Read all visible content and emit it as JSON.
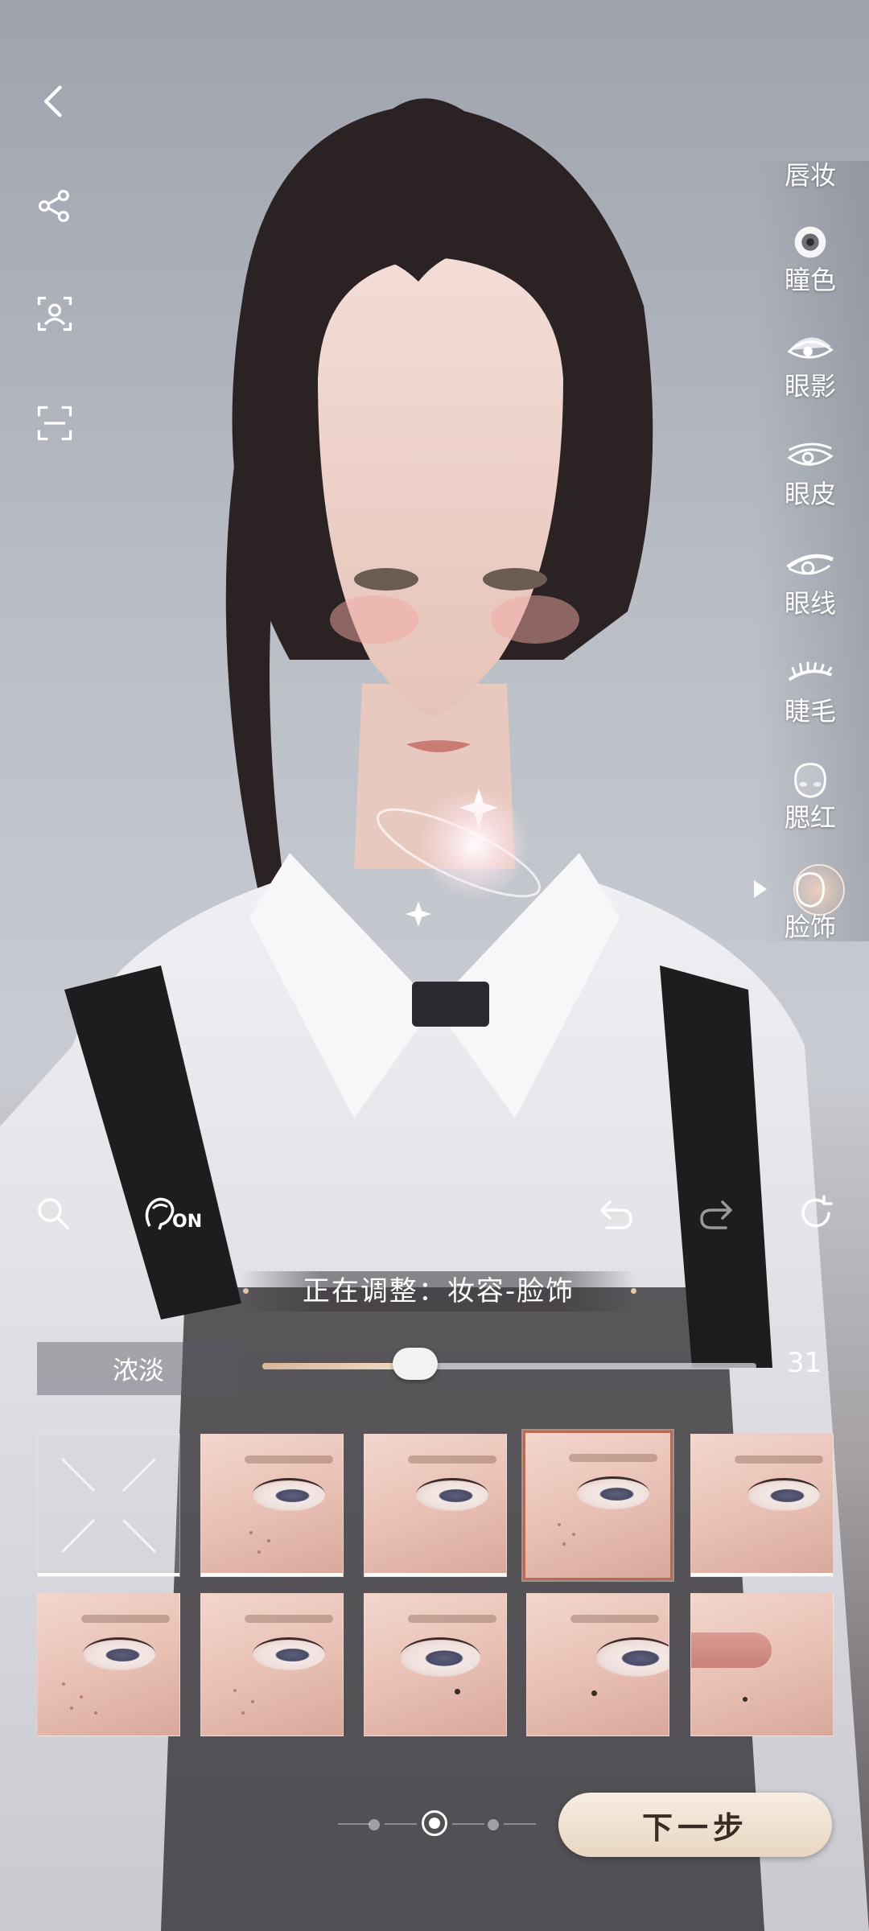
{
  "categories": [
    {
      "label": "唇妆",
      "icon": "lips-icon"
    },
    {
      "label": "瞳色",
      "icon": "pupil-icon"
    },
    {
      "label": "眼影",
      "icon": "eyeshadow-icon"
    },
    {
      "label": "眼皮",
      "icon": "eyelid-icon"
    },
    {
      "label": "眼线",
      "icon": "eyeliner-icon"
    },
    {
      "label": "睫毛",
      "icon": "eyelash-icon"
    },
    {
      "label": "腮红",
      "icon": "blush-icon"
    },
    {
      "label": "脸饰",
      "icon": "face-decoration-icon",
      "selected": true
    }
  ],
  "toolbar": {
    "on_label": "ON"
  },
  "status": {
    "text": "正在调整：妆容-脸饰"
  },
  "slider": {
    "label": "浓淡",
    "value": "31",
    "fraction": 0.31
  },
  "grid": {
    "selected_index": 3
  },
  "pager": {
    "active_index": 1,
    "count": 3
  },
  "next_button": {
    "label": "下一步"
  }
}
